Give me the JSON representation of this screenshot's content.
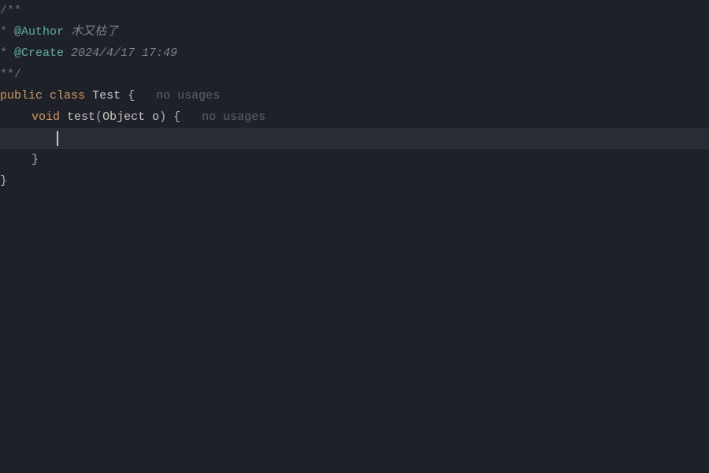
{
  "code": {
    "doc_open": "/**",
    "author_star": "* ",
    "author_tag": "@Author",
    "author_value": " 木又枯了",
    "create_star": "* ",
    "create_tag": "@Create",
    "create_value": " 2024/4/17 17:49",
    "doc_close": "**/",
    "kw_public": "public",
    "kw_class": "class",
    "class_name": "Test",
    "brace_open": "{",
    "hint_class": "no usages",
    "kw_void": "void",
    "method_name": "test",
    "paren_open": "(",
    "param_type": "Object",
    "param_name": "o",
    "paren_close": ")",
    "method_brace_open": "{",
    "hint_method": "no usages",
    "method_brace_close": "}",
    "class_brace_close": "}"
  },
  "icons": {
    "intention": "lightbulb-icon"
  }
}
